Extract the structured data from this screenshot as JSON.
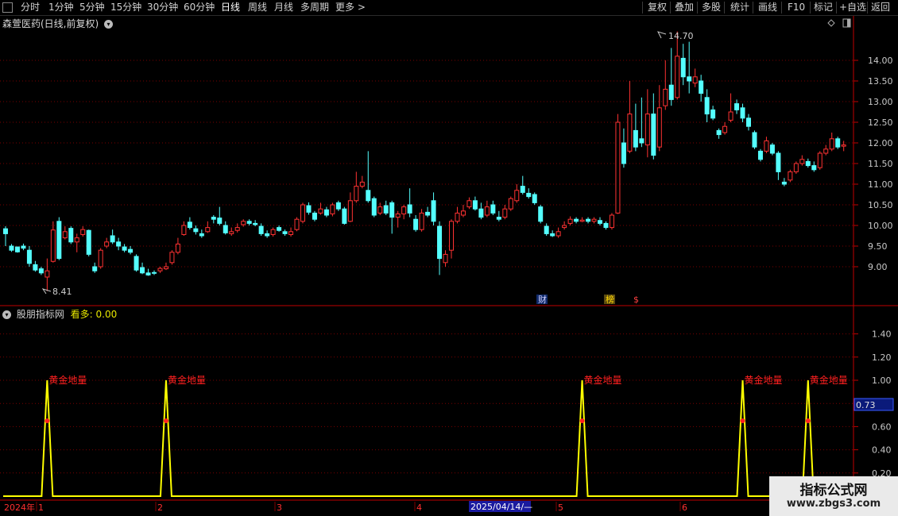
{
  "toolbar": {
    "icon": "window-icon",
    "periods": [
      "分时",
      "1分钟",
      "5分钟",
      "15分钟",
      "30分钟",
      "60分钟",
      "日线",
      "周线",
      "月线",
      "多周期",
      "更多 >"
    ],
    "active_period": "日线",
    "right_buttons": [
      "复权",
      "叠加",
      "多股",
      "统计",
      "画线",
      "F10",
      "+自选",
      "返回"
    ],
    "mark_label": "标记"
  },
  "stock": {
    "title": "森萱医药(日线,前复权)",
    "high_label": "14.70",
    "low_label": "8.41",
    "price_ticks": [
      "14.00",
      "13.50",
      "13.00",
      "12.50",
      "12.00",
      "11.50",
      "11.00",
      "10.50",
      "10.00",
      "9.50",
      "9.00"
    ],
    "event_marks": [
      "财",
      "榜",
      "$"
    ]
  },
  "indicator": {
    "name": "股朋指标网",
    "param_label": "看多:",
    "param_value": "0.00",
    "ticks": [
      "1.40",
      "1.20",
      "1.00",
      "0.80",
      "0.60",
      "0.40",
      "0.20"
    ],
    "current_value": "0.73",
    "signal_label": "黄金地量",
    "colors": {
      "line": "#ffff00",
      "label": "#ff2020",
      "point": "#ff2020"
    }
  },
  "timeline": {
    "labels": [
      "2024年",
      "1",
      "2",
      "3",
      "4",
      "5",
      "6"
    ],
    "cursor_label": "2025/04/14/—"
  },
  "watermark": {
    "title": "指标公式网",
    "url": "www.zbgs3.com"
  },
  "colors": {
    "up": "#ff3232",
    "down": "#54ffff",
    "grid": "#7a0000",
    "axis": "#c00000"
  },
  "chart_data": {
    "type": "candlestick",
    "title": "森萱医药(日线,前复权)",
    "y_range": [
      8.41,
      14.7
    ],
    "candles": [
      [
        9.92,
        9.8,
        9.98,
        9.5
      ],
      [
        9.5,
        9.4,
        9.55,
        9.36
      ],
      [
        9.48,
        9.36,
        9.48,
        9.34
      ],
      [
        9.5,
        9.45,
        9.56,
        9.4
      ],
      [
        9.4,
        9.08,
        9.5,
        9.0
      ],
      [
        9.05,
        8.92,
        9.14,
        8.88
      ],
      [
        8.95,
        8.85,
        9.0,
        8.8
      ],
      [
        8.75,
        8.9,
        9.2,
        8.41
      ],
      [
        9.13,
        9.89,
        10.1,
        9.1
      ],
      [
        10.1,
        9.2,
        10.2,
        9.16
      ],
      [
        9.7,
        9.85,
        9.98,
        9.66
      ],
      [
        9.93,
        9.6,
        9.98,
        9.55
      ],
      [
        9.6,
        9.7,
        9.8,
        9.35
      ],
      [
        9.78,
        9.9,
        9.98,
        9.73
      ],
      [
        9.88,
        9.3,
        9.9,
        9.25
      ],
      [
        9.0,
        8.9,
        9.1,
        8.85
      ],
      [
        9.0,
        9.4,
        9.45,
        8.95
      ],
      [
        9.5,
        9.6,
        9.7,
        9.45
      ],
      [
        9.75,
        9.6,
        9.9,
        9.55
      ],
      [
        9.6,
        9.5,
        9.7,
        9.4
      ],
      [
        9.48,
        9.4,
        9.55,
        9.35
      ],
      [
        9.42,
        9.35,
        9.5,
        9.3
      ],
      [
        9.25,
        8.92,
        9.3,
        8.88
      ],
      [
        8.98,
        8.85,
        9.1,
        8.82
      ],
      [
        8.85,
        8.8,
        8.95,
        8.78
      ],
      [
        8.86,
        8.85,
        8.91,
        8.8
      ],
      [
        8.9,
        8.96,
        9.0,
        8.85
      ],
      [
        8.95,
        9.0,
        9.1,
        8.92
      ],
      [
        9.1,
        9.35,
        9.4,
        9.05
      ],
      [
        9.35,
        9.55,
        9.7,
        9.3
      ],
      [
        9.78,
        10.0,
        10.1,
        9.75
      ],
      [
        10.08,
        9.95,
        10.2,
        9.9
      ],
      [
        9.92,
        9.85,
        10.0,
        9.78
      ],
      [
        9.8,
        9.75,
        9.9,
        9.7
      ],
      [
        9.85,
        9.95,
        10.1,
        9.82
      ],
      [
        10.2,
        10.15,
        10.25,
        10.05
      ],
      [
        10.18,
        10.05,
        10.45,
        10.0
      ],
      [
        10.0,
        9.82,
        10.1,
        9.78
      ],
      [
        9.8,
        9.85,
        9.95,
        9.75
      ],
      [
        9.88,
        9.95,
        10.05,
        9.83
      ],
      [
        10.02,
        10.1,
        10.15,
        9.97
      ],
      [
        10.1,
        10.05,
        10.15,
        10.0
      ],
      [
        10.05,
        10.02,
        10.13,
        9.98
      ],
      [
        9.98,
        9.8,
        10.05,
        9.75
      ],
      [
        9.8,
        9.75,
        9.88,
        9.7
      ],
      [
        9.78,
        9.9,
        9.95,
        9.73
      ],
      [
        9.95,
        9.88,
        10.0,
        9.85
      ],
      [
        9.85,
        9.8,
        9.9,
        9.75
      ],
      [
        9.78,
        9.85,
        9.95,
        9.73
      ],
      [
        9.9,
        10.15,
        10.2,
        9.86
      ],
      [
        10.1,
        10.5,
        10.55,
        10.05
      ],
      [
        10.48,
        10.32,
        10.56,
        10.26
      ],
      [
        10.3,
        10.15,
        10.35,
        10.1
      ],
      [
        10.3,
        10.4,
        10.55,
        10.26
      ],
      [
        10.38,
        10.25,
        10.45,
        10.2
      ],
      [
        10.28,
        10.5,
        10.55,
        10.22
      ],
      [
        10.55,
        10.4,
        10.6,
        10.35
      ],
      [
        10.4,
        10.05,
        10.45,
        10.02
      ],
      [
        10.1,
        10.6,
        10.8,
        10.08
      ],
      [
        10.6,
        10.95,
        11.3,
        10.55
      ],
      [
        10.95,
        11.05,
        11.2,
        10.9
      ],
      [
        10.85,
        10.6,
        11.8,
        10.55
      ],
      [
        10.65,
        10.25,
        10.7,
        10.2
      ],
      [
        10.3,
        10.45,
        10.55,
        10.25
      ],
      [
        10.48,
        10.3,
        10.6,
        10.25
      ],
      [
        10.55,
        10.2,
        10.6,
        9.8
      ],
      [
        10.2,
        10.28,
        10.35,
        9.95
      ],
      [
        10.28,
        10.45,
        10.5,
        10.15
      ],
      [
        10.5,
        10.3,
        10.9,
        10.2
      ],
      [
        10.15,
        9.9,
        10.25,
        9.85
      ],
      [
        9.9,
        10.3,
        10.4,
        9.85
      ],
      [
        10.32,
        10.25,
        10.45,
        10.2
      ],
      [
        10.6,
        10.1,
        10.8,
        10.0
      ],
      [
        9.98,
        9.2,
        10.1,
        8.8
      ],
      [
        9.1,
        9.3,
        9.4,
        9.0
      ],
      [
        9.4,
        10.1,
        10.15,
        9.2
      ],
      [
        10.1,
        10.3,
        10.45,
        10.05
      ],
      [
        10.25,
        10.35,
        10.5,
        10.2
      ],
      [
        10.45,
        10.6,
        10.68,
        10.4
      ],
      [
        10.6,
        10.4,
        10.7,
        10.36
      ],
      [
        10.4,
        10.2,
        10.55,
        10.15
      ],
      [
        10.25,
        10.45,
        10.6,
        10.2
      ],
      [
        10.5,
        10.3,
        10.6,
        10.25
      ],
      [
        10.2,
        10.15,
        10.35,
        10.1
      ],
      [
        10.2,
        10.4,
        10.5,
        10.15
      ],
      [
        10.4,
        10.65,
        10.7,
        10.35
      ],
      [
        10.6,
        10.85,
        11.0,
        10.55
      ],
      [
        10.95,
        10.8,
        11.2,
        10.75
      ],
      [
        10.78,
        10.7,
        10.9,
        10.65
      ],
      [
        10.75,
        10.55,
        10.8,
        10.5
      ],
      [
        10.45,
        10.1,
        10.5,
        10.05
      ],
      [
        9.98,
        9.8,
        10.05,
        9.75
      ],
      [
        9.8,
        9.75,
        9.88,
        9.72
      ],
      [
        9.75,
        9.85,
        9.95,
        9.7
      ],
      [
        9.95,
        10.0,
        10.1,
        9.9
      ],
      [
        10.05,
        10.15,
        10.22,
        10.0
      ],
      [
        10.15,
        10.1,
        10.2,
        10.05
      ],
      [
        10.1,
        10.13,
        10.2,
        10.08
      ],
      [
        10.15,
        10.1,
        10.2,
        10.05
      ],
      [
        10.1,
        10.15,
        10.2,
        10.05
      ],
      [
        10.12,
        10.05,
        10.2,
        10.0
      ],
      [
        10.05,
        9.95,
        10.1,
        9.9
      ],
      [
        9.95,
        10.25,
        10.3,
        9.9
      ],
      [
        10.3,
        12.5,
        12.7,
        10.28
      ],
      [
        12.0,
        11.5,
        12.35,
        11.4
      ],
      [
        11.8,
        12.7,
        13.5,
        11.75
      ],
      [
        12.3,
        11.9,
        12.95,
        11.8
      ],
      [
        12.1,
        12.0,
        13.1,
        11.9
      ],
      [
        11.95,
        12.7,
        13.3,
        11.65
      ],
      [
        12.7,
        11.7,
        13.2,
        11.6
      ],
      [
        11.9,
        12.85,
        13.4,
        11.8
      ],
      [
        12.9,
        13.3,
        14.0,
        12.8
      ],
      [
        13.4,
        13.05,
        14.3,
        12.9
      ],
      [
        13.1,
        14.1,
        14.7,
        13.05
      ],
      [
        14.05,
        13.6,
        14.4,
        13.4
      ],
      [
        13.6,
        13.5,
        14.45,
        13.2
      ],
      [
        13.45,
        13.6,
        13.8,
        13.35
      ],
      [
        13.5,
        13.2,
        13.65,
        13.0
      ],
      [
        13.1,
        12.7,
        13.3,
        12.5
      ],
      [
        12.8,
        12.6,
        12.9,
        12.55
      ],
      [
        12.3,
        12.2,
        12.35,
        12.1
      ],
      [
        12.25,
        12.4,
        12.5,
        12.2
      ],
      [
        12.55,
        12.75,
        13.2,
        12.5
      ],
      [
        12.95,
        12.8,
        13.05,
        12.7
      ],
      [
        12.85,
        12.6,
        12.95,
        12.5
      ],
      [
        12.6,
        12.4,
        12.7,
        12.3
      ],
      [
        12.25,
        11.9,
        12.3,
        11.85
      ],
      [
        11.8,
        11.6,
        11.85,
        11.55
      ],
      [
        11.8,
        12.05,
        12.15,
        11.75
      ],
      [
        11.95,
        11.75,
        12.0,
        11.7
      ],
      [
        11.75,
        11.3,
        11.8,
        11.1
      ],
      [
        11.05,
        11.0,
        11.15,
        10.95
      ],
      [
        11.1,
        11.3,
        11.35,
        11.05
      ],
      [
        11.3,
        11.5,
        11.55,
        11.25
      ],
      [
        11.5,
        11.6,
        11.7,
        11.45
      ],
      [
        11.55,
        11.45,
        11.62,
        11.4
      ],
      [
        11.45,
        11.35,
        11.55,
        11.3
      ],
      [
        11.4,
        11.75,
        11.8,
        11.35
      ],
      [
        11.75,
        11.85,
        11.95,
        11.7
      ],
      [
        11.85,
        12.1,
        12.25,
        11.8
      ],
      [
        12.1,
        11.9,
        12.15,
        11.85
      ],
      [
        11.92,
        11.95,
        12.05,
        11.8
      ]
    ],
    "indicator": {
      "name": "股朋指标网",
      "y_range": [
        0,
        1.6
      ],
      "baseline": 0,
      "spikes": [
        {
          "index": 7,
          "peak": 1.0,
          "label": "黄金地量"
        },
        {
          "index": 27,
          "peak": 1.0,
          "label": "黄金地量"
        },
        {
          "index": 97,
          "peak": 1.0,
          "label": "黄金地量"
        },
        {
          "index": 124,
          "peak": 1.0,
          "label": "黄金地量"
        },
        {
          "index": 135,
          "peak": 1.0,
          "label": "黄金地量"
        }
      ]
    }
  }
}
